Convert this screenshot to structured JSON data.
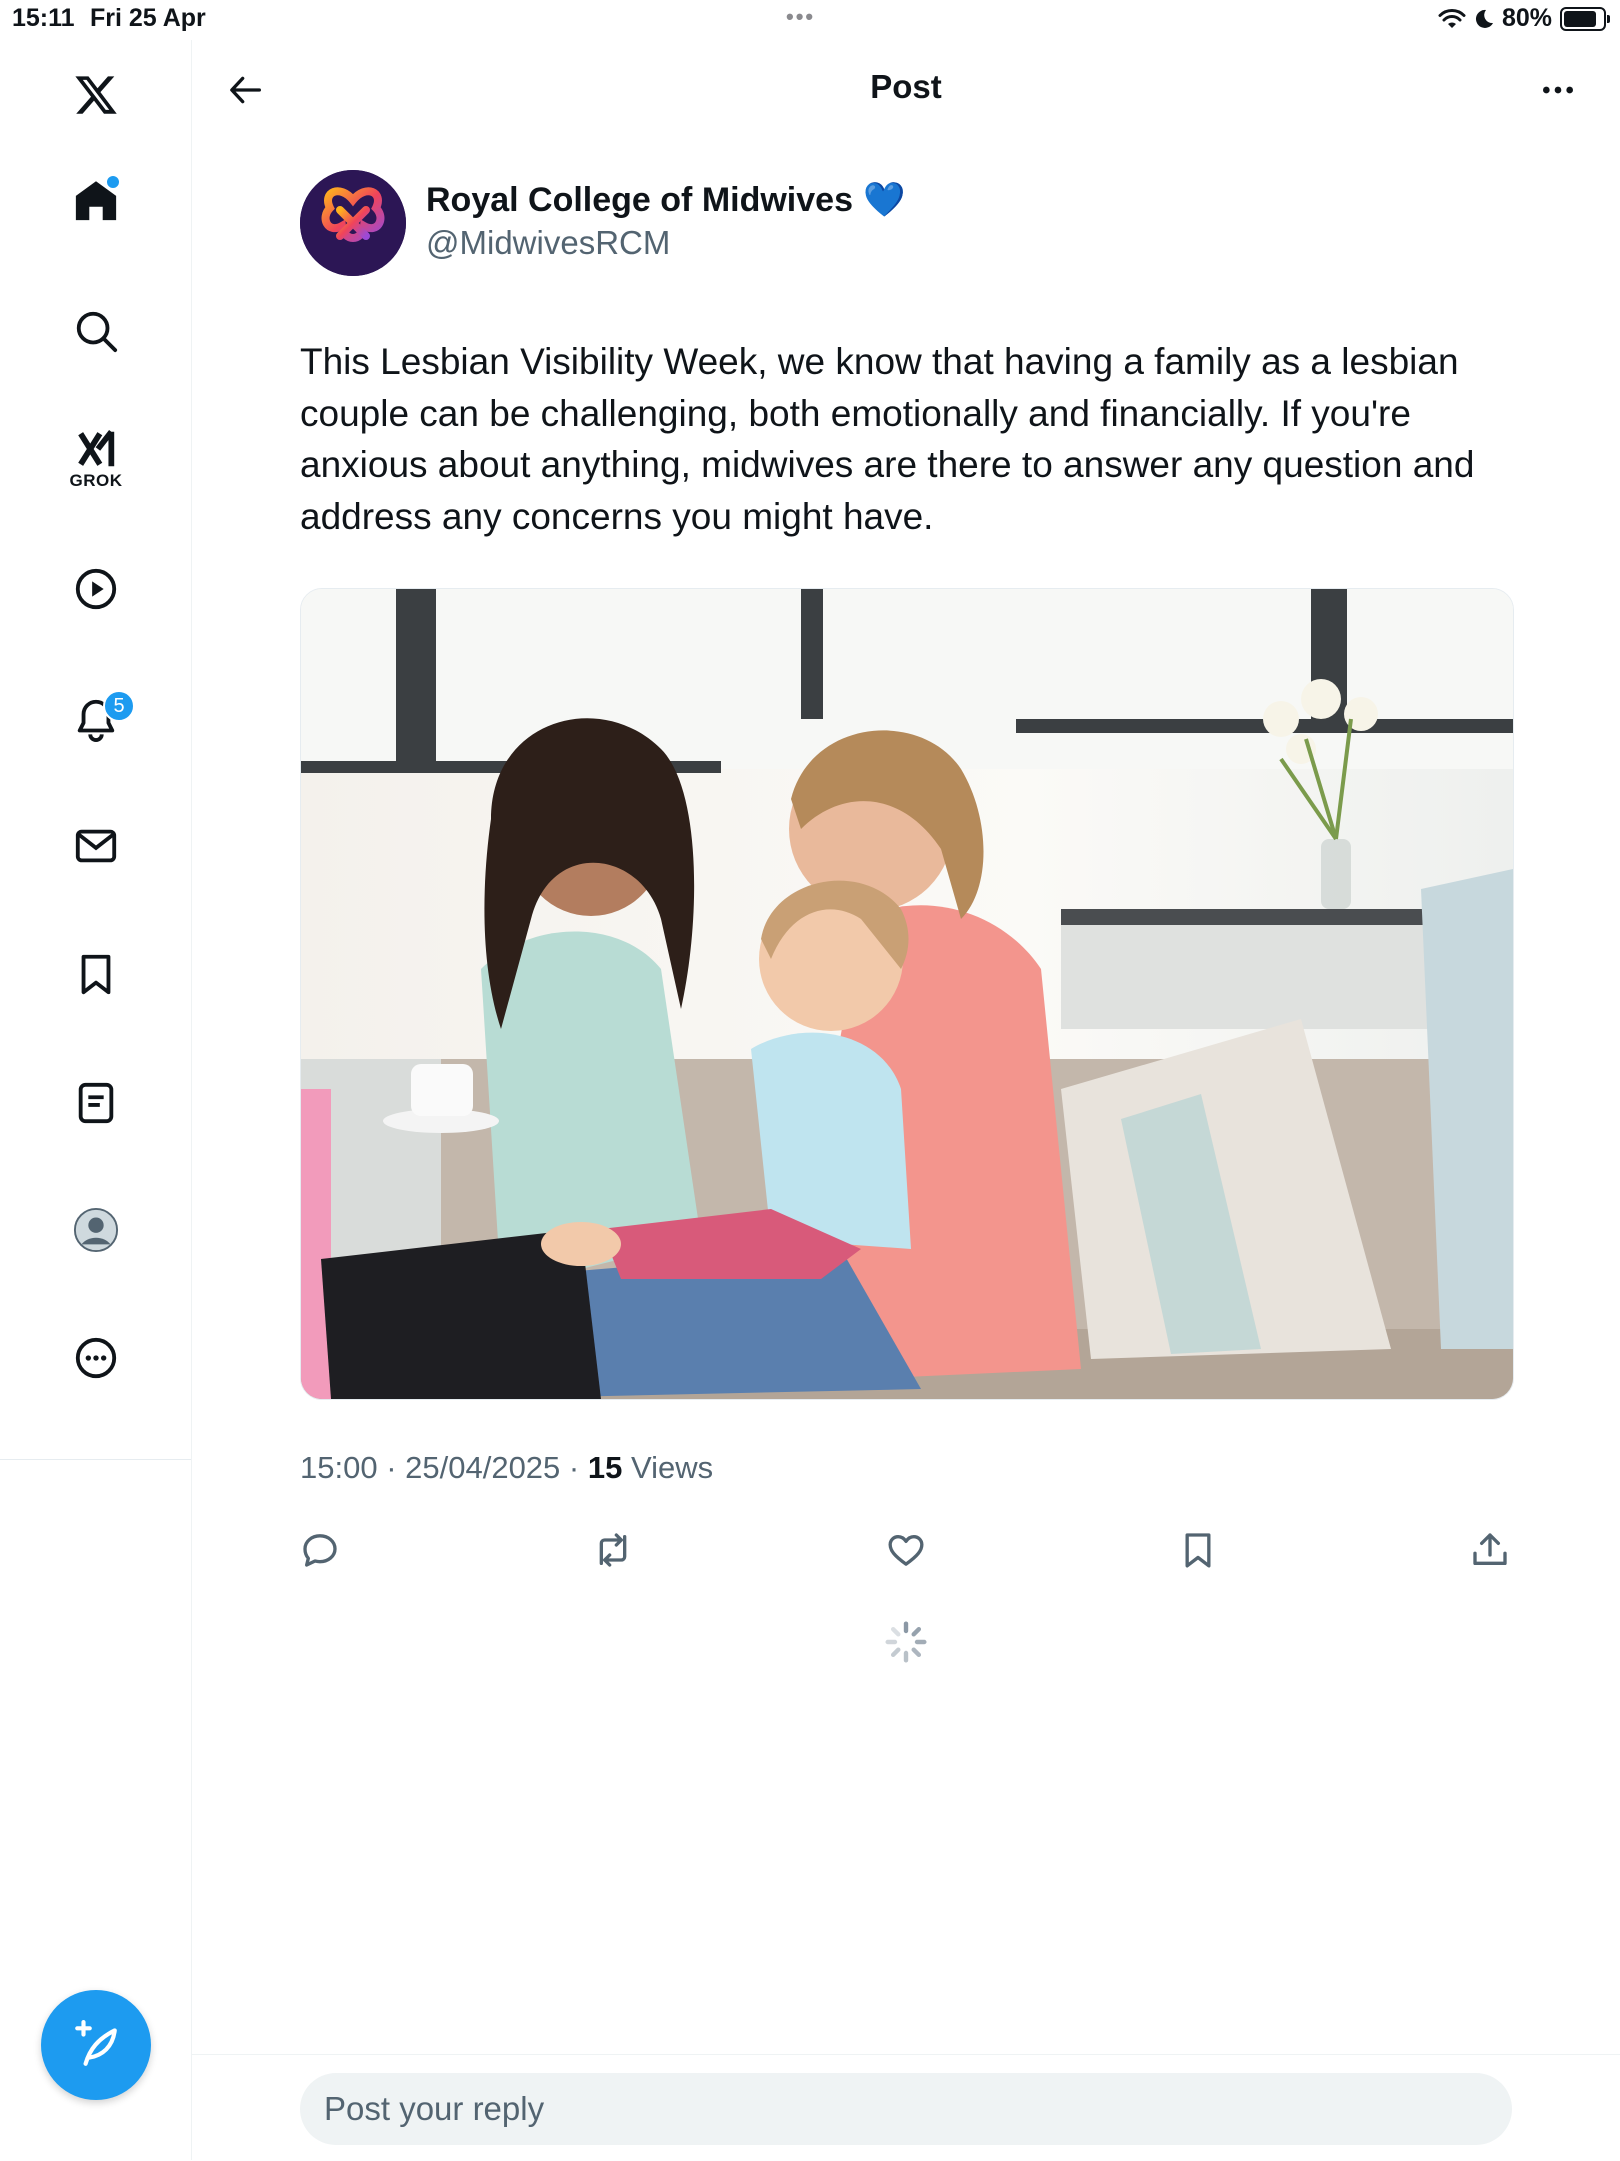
{
  "status_bar": {
    "time": "15:11",
    "date": "Fri 25 Apr",
    "dots": "•••",
    "battery": "80%",
    "battery_level": 0.8
  },
  "sidebar": {
    "items": [
      {
        "icon": "x-logo-icon"
      },
      {
        "icon": "home-icon",
        "has_dot": true
      },
      {
        "icon": "search-icon"
      },
      {
        "icon": "grok-icon",
        "label": "GROK"
      },
      {
        "icon": "play-icon"
      },
      {
        "icon": "bell-icon",
        "badge": "5"
      },
      {
        "icon": "mail-icon"
      },
      {
        "icon": "bookmark-icon"
      },
      {
        "icon": "list-icon"
      },
      {
        "icon": "profile-icon"
      },
      {
        "icon": "more-circle-icon"
      }
    ],
    "compose_icon": "feather-plus-icon"
  },
  "header": {
    "title": "Post",
    "back_icon": "arrow-left-icon",
    "more_icon": "ellipsis-icon"
  },
  "post": {
    "author_name": "Royal College of Midwives",
    "verified_badge": "💙",
    "author_handle": "@MidwivesRCM",
    "text": "This Lesbian Visibility Week, we know that having a family as a lesbian couple can be challenging, both emotionally and financially. If you're anxious about anything, midwives are there to answer any question and address any concerns you might have.",
    "time": "15:00",
    "date": "25/04/2025",
    "views_count": "15",
    "views_label": "Views",
    "actions": [
      "reply-icon",
      "repost-icon",
      "like-icon",
      "bookmark-icon",
      "share-icon"
    ]
  },
  "reply": {
    "placeholder": "Post your reply"
  },
  "colors": {
    "accent": "#1d9bf0",
    "text": "#0f1419",
    "secondary": "#536471",
    "input_bg": "#eff3f4"
  }
}
